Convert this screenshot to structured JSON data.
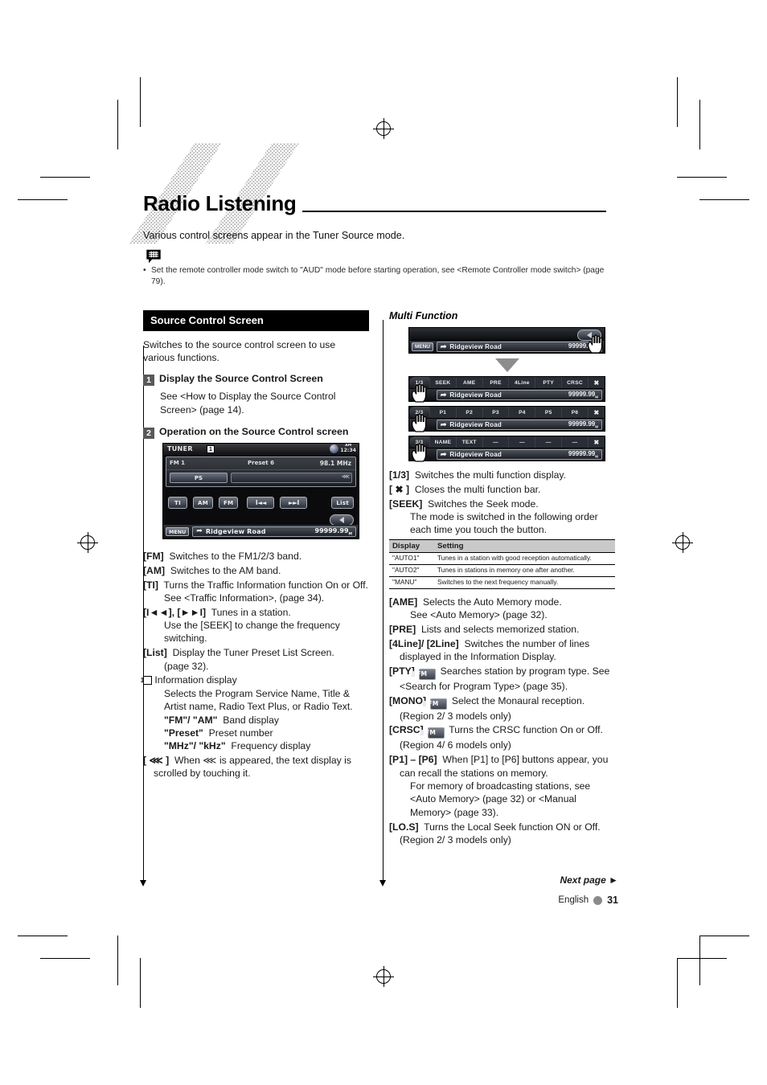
{
  "page": {
    "title": "Radio Listening",
    "intro": "Various control screens appear in the Tuner Source mode.",
    "note_bullet": "•",
    "note": "Set the remote controller mode switch to \"AUD\" mode before starting operation, see <Remote Controller mode switch> (page 79).",
    "next_page": "Next page ►",
    "language": "English",
    "page_number": "31"
  },
  "left": {
    "section_title": "Source Control Screen",
    "intro": "Switches to the source control screen to use various functions.",
    "step1_num": "1",
    "step1_title": "Display the Source Control Screen",
    "step1_body": "See <How to Display the Source Control Screen> (page 14).",
    "step2_num": "2",
    "step2_title": "Operation on the Source Control screen",
    "items": [
      {
        "key": "[FM]",
        "text": "Switches to the FM1/2/3 band."
      },
      {
        "key": "[AM]",
        "text": "Switches to the AM band."
      },
      {
        "key": "[TI]",
        "text": "Turns the Traffic Information function On or Off."
      },
      {
        "key": "[I◄◄], [►►I]",
        "text": "Tunes in a station."
      },
      {
        "key": "[List]",
        "text": "Display the Tuner Preset List Screen."
      }
    ],
    "ti_see": "See <Traffic Information>, (page 34).",
    "seek_sub": "Use the [SEEK] to change the frequency switching.",
    "list_sub": "(page 32).",
    "info_num": "1",
    "info_label": "Information display",
    "info_body": "Selects the Program Service Name, Title & Artist name, Radio Text Plus, or Radio Text.",
    "sub_items": [
      {
        "key": "\"FM\"/ \"AM\"",
        "text": "Band display"
      },
      {
        "key": "\"Preset\"",
        "text": "Preset number"
      },
      {
        "key": "\"MHz\"/ \"kHz\"",
        "text": "Frequency display"
      }
    ],
    "scroll_item_key": "[ ⋘ ]",
    "scroll_item_text": "When ⋘ is appeared, the text display is scrolled by touching it."
  },
  "device": {
    "source": "TUNER",
    "clock_ampm": "AM",
    "clock_time": "12:34",
    "band": "FM 1",
    "preset": "Preset 6",
    "frequency": "98.1 MHz",
    "ps_label": "PS",
    "scroll_glyph": "⋘",
    "callout": "1",
    "buttons": [
      "TI",
      "AM",
      "FM"
    ],
    "seek_prev": "I◄◄",
    "seek_next": "►►I",
    "list_button": "List",
    "menu_button": "MENU",
    "track_name": "Ridgeview Road",
    "track_value": "99999.99",
    "track_unit": "M"
  },
  "right": {
    "section_title": "Multi Function",
    "bars": [
      {
        "index": "1/3",
        "cells": [
          "SEEK",
          "AME",
          "PRE",
          "4Line",
          "PTY",
          "CRSC"
        ],
        "close": "✖"
      },
      {
        "index": "2/3",
        "cells": [
          "P1",
          "P2",
          "P3",
          "P4",
          "P5",
          "P6"
        ],
        "close": "✖"
      },
      {
        "index": "3/3",
        "cells": [
          "NAME",
          "TEXT",
          "—",
          "—",
          "—",
          "—"
        ],
        "close": "✖"
      }
    ],
    "items": [
      {
        "key": "[1/3]",
        "text": "Switches the multi function display."
      },
      {
        "key": "[ ✖ ]",
        "text": "Closes the multi function bar."
      },
      {
        "key": "[SEEK]",
        "text": "Switches the Seek mode."
      }
    ],
    "seek_note": "The mode is switched in the following order each time you touch the button.",
    "table": {
      "headers": [
        "Display",
        "Setting"
      ],
      "rows": [
        [
          "\"AUTO1\"",
          "Tunes in a station with good reception automatically."
        ],
        [
          "\"AUTO2\"",
          "Tunes in stations in memory one after another."
        ],
        [
          "\"MANU\"",
          "Switches to the next frequency manually."
        ]
      ]
    },
    "ame_key": "[AME]",
    "ame_text": "Selects the Auto Memory mode.",
    "ame_sub": "See <Auto Memory> (page 32).",
    "pre_key": "[PRE]",
    "pre_text": "Lists and selects memorized station.",
    "line_key": "[4Line]/ [2Line]",
    "line_text": "Switches the number of lines displayed in the Information Display.",
    "pty_key": "[PTY]",
    "pty_text": "Searches station by program type. See <Search for Program Type> (page 35).",
    "mono_key": "[MONO]",
    "mono_text": "Select the Monaural reception. (Region 2/ 3 models only)",
    "crsc_key": "[CRSC]",
    "crsc_text": "Turns the CRSC function On or Off. (Region 4/ 6 models only)",
    "p_key": "[P1] – [P6]",
    "p_text": "When [P1] to [P6] buttons appear, you can recall the stations on memory.",
    "p_sub": "For memory of broadcasting stations, see <Auto Memory> (page 32) or <Manual Memory> (page 33).",
    "los_key": "[LO.S]",
    "los_text": "Turns the Local Seek function ON or Off. (Region 2/ 3 models only)",
    "fm_badge": "FM"
  }
}
